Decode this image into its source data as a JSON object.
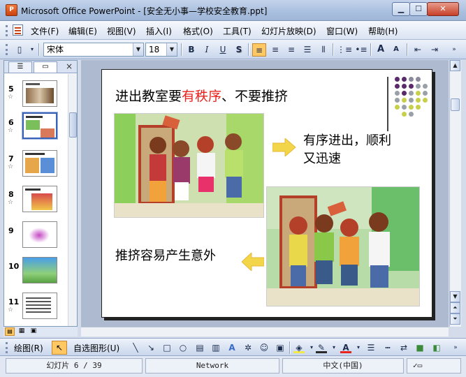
{
  "window": {
    "title": "Microsoft Office PowerPoint - [安全无小事—学校安全教育.ppt]",
    "app_icon_text": "P",
    "minimize": "▁",
    "maximize": "☐",
    "close": "✕"
  },
  "menu": {
    "items": [
      "文件(F)",
      "编辑(E)",
      "视图(V)",
      "插入(I)",
      "格式(O)",
      "工具(T)",
      "幻灯片放映(D)",
      "窗口(W)",
      "帮助(H)"
    ]
  },
  "toolbar": {
    "font_name": "宋体",
    "font_size": "18",
    "bold": "B",
    "italic": "I",
    "underline": "U",
    "shadow": "S",
    "grow_font": "A",
    "shrink_font": "A"
  },
  "outline_pane": {
    "slides": [
      {
        "num": "5"
      },
      {
        "num": "6"
      },
      {
        "num": "7"
      },
      {
        "num": "8"
      },
      {
        "num": "9"
      },
      {
        "num": "10"
      },
      {
        "num": "11"
      }
    ],
    "selected": "6",
    "close": "×"
  },
  "slide": {
    "title_prefix": "进出教室要",
    "title_highlight": "有秩序",
    "title_suffix": "、不要推挤",
    "caption_right_line1": "有序进出，顺利",
    "caption_right_line2": "又迅速",
    "caption_left": "推挤容易产生意外"
  },
  "drawing_toolbar": {
    "draw_label": "绘图(R)",
    "autoshapes_label": "自选图形(U)"
  },
  "status": {
    "slide_label": "幻灯片 6 / 39",
    "template": "Network",
    "language": "中文(中国)"
  },
  "colors": {
    "highlight_red": "#e8231e",
    "arrow_yellow": "#f3d54a"
  }
}
